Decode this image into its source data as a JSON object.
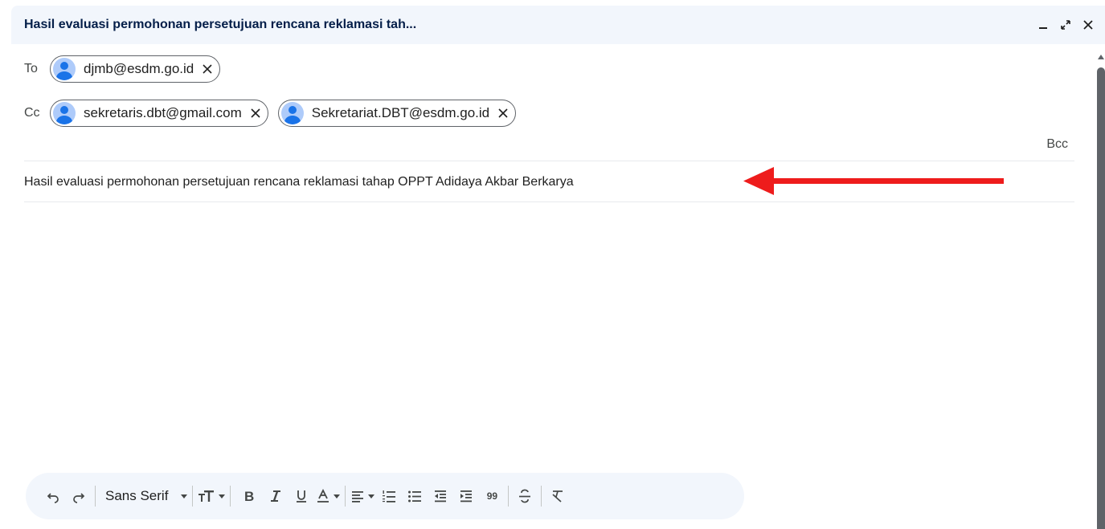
{
  "window": {
    "title": "Hasil evaluasi permohonan persetujuan rencana reklamasi tah...",
    "controls": [
      "minimize-icon",
      "full-screen-icon",
      "close-icon"
    ]
  },
  "recipients": {
    "to_label": "To",
    "to": [
      {
        "email": "djmb@esdm.go.id"
      }
    ],
    "cc_label": "Cc",
    "cc": [
      {
        "email": "sekretaris.dbt@gmail.com"
      },
      {
        "email": "Sekretariat.DBT@esdm.go.id"
      }
    ],
    "bcc_label": "Bcc"
  },
  "subject": {
    "value": "Hasil evaluasi permohonan persetujuan rencana reklamasi tahap OPPT Adidaya Akbar Berkarya"
  },
  "annotation": {
    "arrow_color": "#ee1c1c"
  },
  "toolbar": {
    "font_name": "Sans Serif",
    "quote_label": "99",
    "icons": [
      "undo-icon",
      "redo-icon",
      "font-size-icon",
      "bold-icon",
      "italic-icon",
      "underline-icon",
      "text-color-icon",
      "align-icon",
      "numbered-list-icon",
      "bulleted-list-icon",
      "indent-less-icon",
      "indent-more-icon",
      "quote-icon",
      "strikethrough-icon",
      "remove-formatting-icon"
    ]
  },
  "colors": {
    "titlebar_bg": "#f2f6fc",
    "title_text": "#041e49",
    "avatar_blue": "#1a73e8"
  }
}
